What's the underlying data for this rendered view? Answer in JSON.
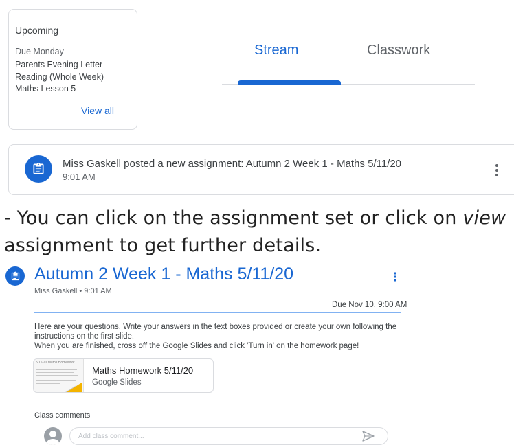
{
  "upcoming": {
    "title": "Upcoming",
    "due_label": "Due Monday",
    "items": [
      "Parents Evening Letter",
      "Reading (Whole Week)",
      "Maths Lesson 5"
    ],
    "view_all": "View all"
  },
  "tabs": [
    {
      "label": "Stream",
      "active": true
    },
    {
      "label": "Classwork",
      "active": false
    }
  ],
  "stream_post": {
    "icon": "assignment-icon",
    "text": "Miss Gaskell posted a new assignment: Autumn 2 Week 1 - Maths 5/11/20",
    "time": "9:01 AM"
  },
  "instructions": {
    "line1": "- You can click on the assignment set or click on ",
    "italic": "view",
    "line2": "assignment to get further details."
  },
  "assignment": {
    "title": "Autumn 2 Week 1 - Maths 5/11/20",
    "meta": "Miss Gaskell • 9:01 AM",
    "due": "Due Nov 10, 9:00 AM",
    "body1": "Here are your questions. Write your answers in the text boxes provided or create your own following the instructions on the first slide.",
    "body2": "When you are finished, cross off the Google Slides and click 'Turn in' on the homework page!",
    "attachment": {
      "thumb_heading": "5/11/20 Maths Homework",
      "title": "Maths Homework 5/11/20",
      "type": "Google Slides"
    },
    "comments_label": "Class comments",
    "comment_placeholder": "Add class comment..."
  },
  "colors": {
    "accent": "#1967d2",
    "slides_yellow": "#f4b400"
  }
}
